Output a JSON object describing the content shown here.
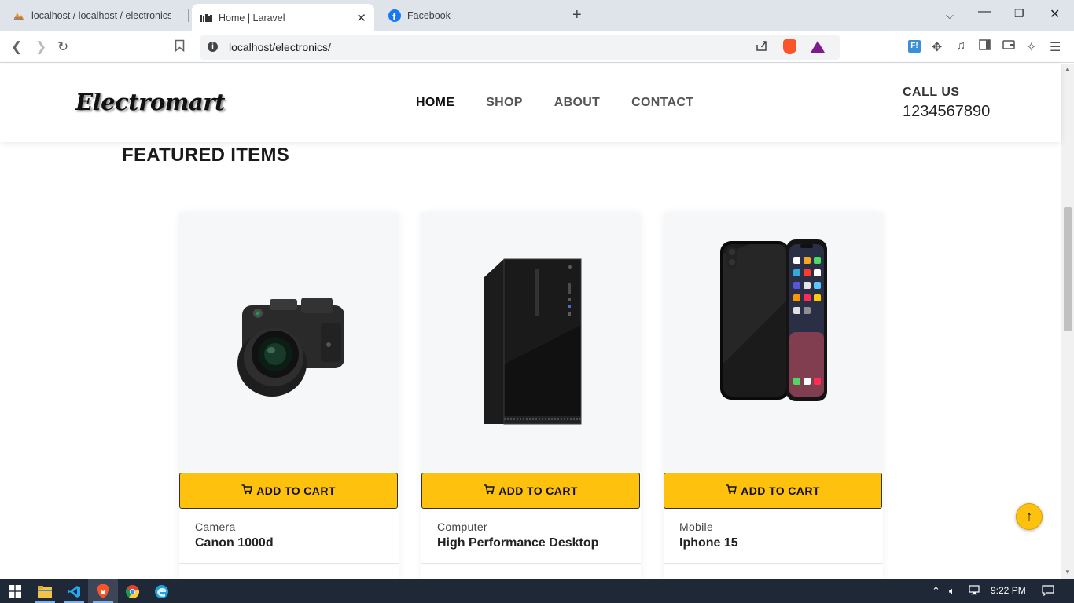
{
  "browser": {
    "tabs": [
      {
        "title": "localhost / localhost / electronics / u",
        "icon": "phpmyadmin-icon",
        "active": false
      },
      {
        "title": "Home | Laravel",
        "icon": "laravel-icon",
        "active": true
      },
      {
        "title": "Facebook",
        "icon": "facebook-icon",
        "active": false
      }
    ],
    "new_tab": "+",
    "url": "localhost/electronics/"
  },
  "site": {
    "logo": "Electromart",
    "nav": [
      {
        "label": "HOME",
        "active": true
      },
      {
        "label": "SHOP",
        "active": false
      },
      {
        "label": "ABOUT",
        "active": false
      },
      {
        "label": "CONTACT",
        "active": false
      }
    ],
    "call_label": "CALL US",
    "call_number": "1234567890"
  },
  "section_title": "FEATURED ITEMS",
  "products": [
    {
      "category": "Camera",
      "name": "Canon 1000d",
      "button": "ADD TO CART",
      "image": "camera"
    },
    {
      "category": "Computer",
      "name": "High Performance Desktop",
      "button": "ADD TO CART",
      "image": "desktop"
    },
    {
      "category": "Mobile",
      "name": "Iphone 15",
      "button": "ADD TO CART",
      "image": "phone"
    }
  ],
  "colors": {
    "accent": "#fdc10e",
    "taskbar": "#1f2836"
  },
  "taskbar": {
    "time": "9:22 PM"
  }
}
